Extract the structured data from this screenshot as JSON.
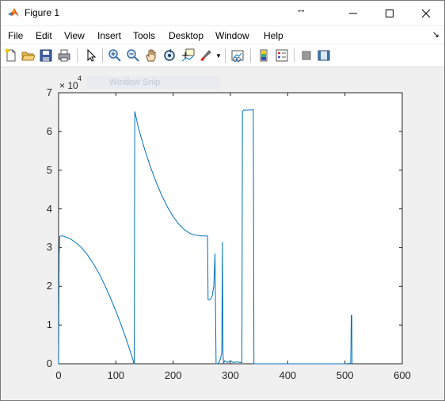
{
  "window": {
    "title": "Figure 1"
  },
  "menu": [
    "File",
    "Edit",
    "View",
    "Insert",
    "Tools",
    "Desktop",
    "Window",
    "Help"
  ],
  "toolbar_icons": [
    "new-figure-icon",
    "open-file-icon",
    "save-icon",
    "print-icon",
    "edit-plot-pointer-icon",
    "zoom-in-icon",
    "zoom-out-icon",
    "pan-icon",
    "rotate-3d-icon",
    "data-cursor-icon",
    "brush-icon",
    "link-plot-icon",
    "colorbar-icon",
    "legend-icon",
    "hide-plot-tools-icon",
    "show-plot-tools-icon"
  ],
  "overlay": {
    "snip_label": "Window Snip"
  },
  "colors": {
    "line": "#0072bd",
    "figure_bg": "#f0f0f0",
    "axes_bg": "#ffffff"
  },
  "chart_data": {
    "type": "line",
    "title": "",
    "xlabel": "",
    "ylabel": "",
    "xlim": [
      0,
      600
    ],
    "ylim": [
      0,
      70000
    ],
    "x_ticks": [
      "0",
      "100",
      "200",
      "300",
      "400",
      "500",
      "600"
    ],
    "y_ticks": [
      "0",
      "1",
      "2",
      "3",
      "4",
      "5",
      "6",
      "7"
    ],
    "y_exponent_base": "× 10",
    "y_exponent_power": "4",
    "grid": false,
    "legend": "none",
    "series": [
      {
        "x": [
          0,
          1,
          2,
          3,
          5,
          10,
          20,
          30,
          40,
          50,
          60,
          70,
          80,
          90,
          100,
          110,
          120,
          130,
          131,
          132,
          133,
          140,
          150,
          160,
          170,
          180,
          190,
          200,
          210,
          220,
          230,
          240,
          250,
          260,
          261,
          262,
          265,
          268,
          271,
          273,
          275,
          277,
          280,
          283,
          285,
          286,
          287,
          288,
          290,
          295,
          300,
          305,
          310,
          320,
          321,
          322,
          323,
          330,
          340,
          341,
          342,
          343,
          345,
          360,
          380,
          400,
          420,
          440,
          460,
          480,
          500,
          510,
          511,
          512,
          512.5
        ],
        "y": [
          0,
          28000,
          32800,
          33000,
          33000,
          32900,
          32300,
          31300,
          30000,
          28200,
          26000,
          23500,
          20500,
          17200,
          13600,
          9700,
          5500,
          1000,
          0,
          0,
          65200,
          60500,
          55500,
          51000,
          47000,
          43500,
          40500,
          38000,
          36000,
          34600,
          33600,
          33200,
          33000,
          33000,
          16500,
          16500,
          16600,
          17500,
          20000,
          28500,
          0,
          0,
          300,
          1500,
          3000,
          31500,
          3000,
          0,
          800,
          300,
          800,
          300,
          500,
          300,
          65000,
          65300,
          65500,
          65500,
          65600,
          0,
          0,
          0,
          0,
          0,
          0,
          0,
          0,
          0,
          0,
          0,
          0,
          100,
          12500,
          12500,
          0
        ]
      }
    ]
  }
}
